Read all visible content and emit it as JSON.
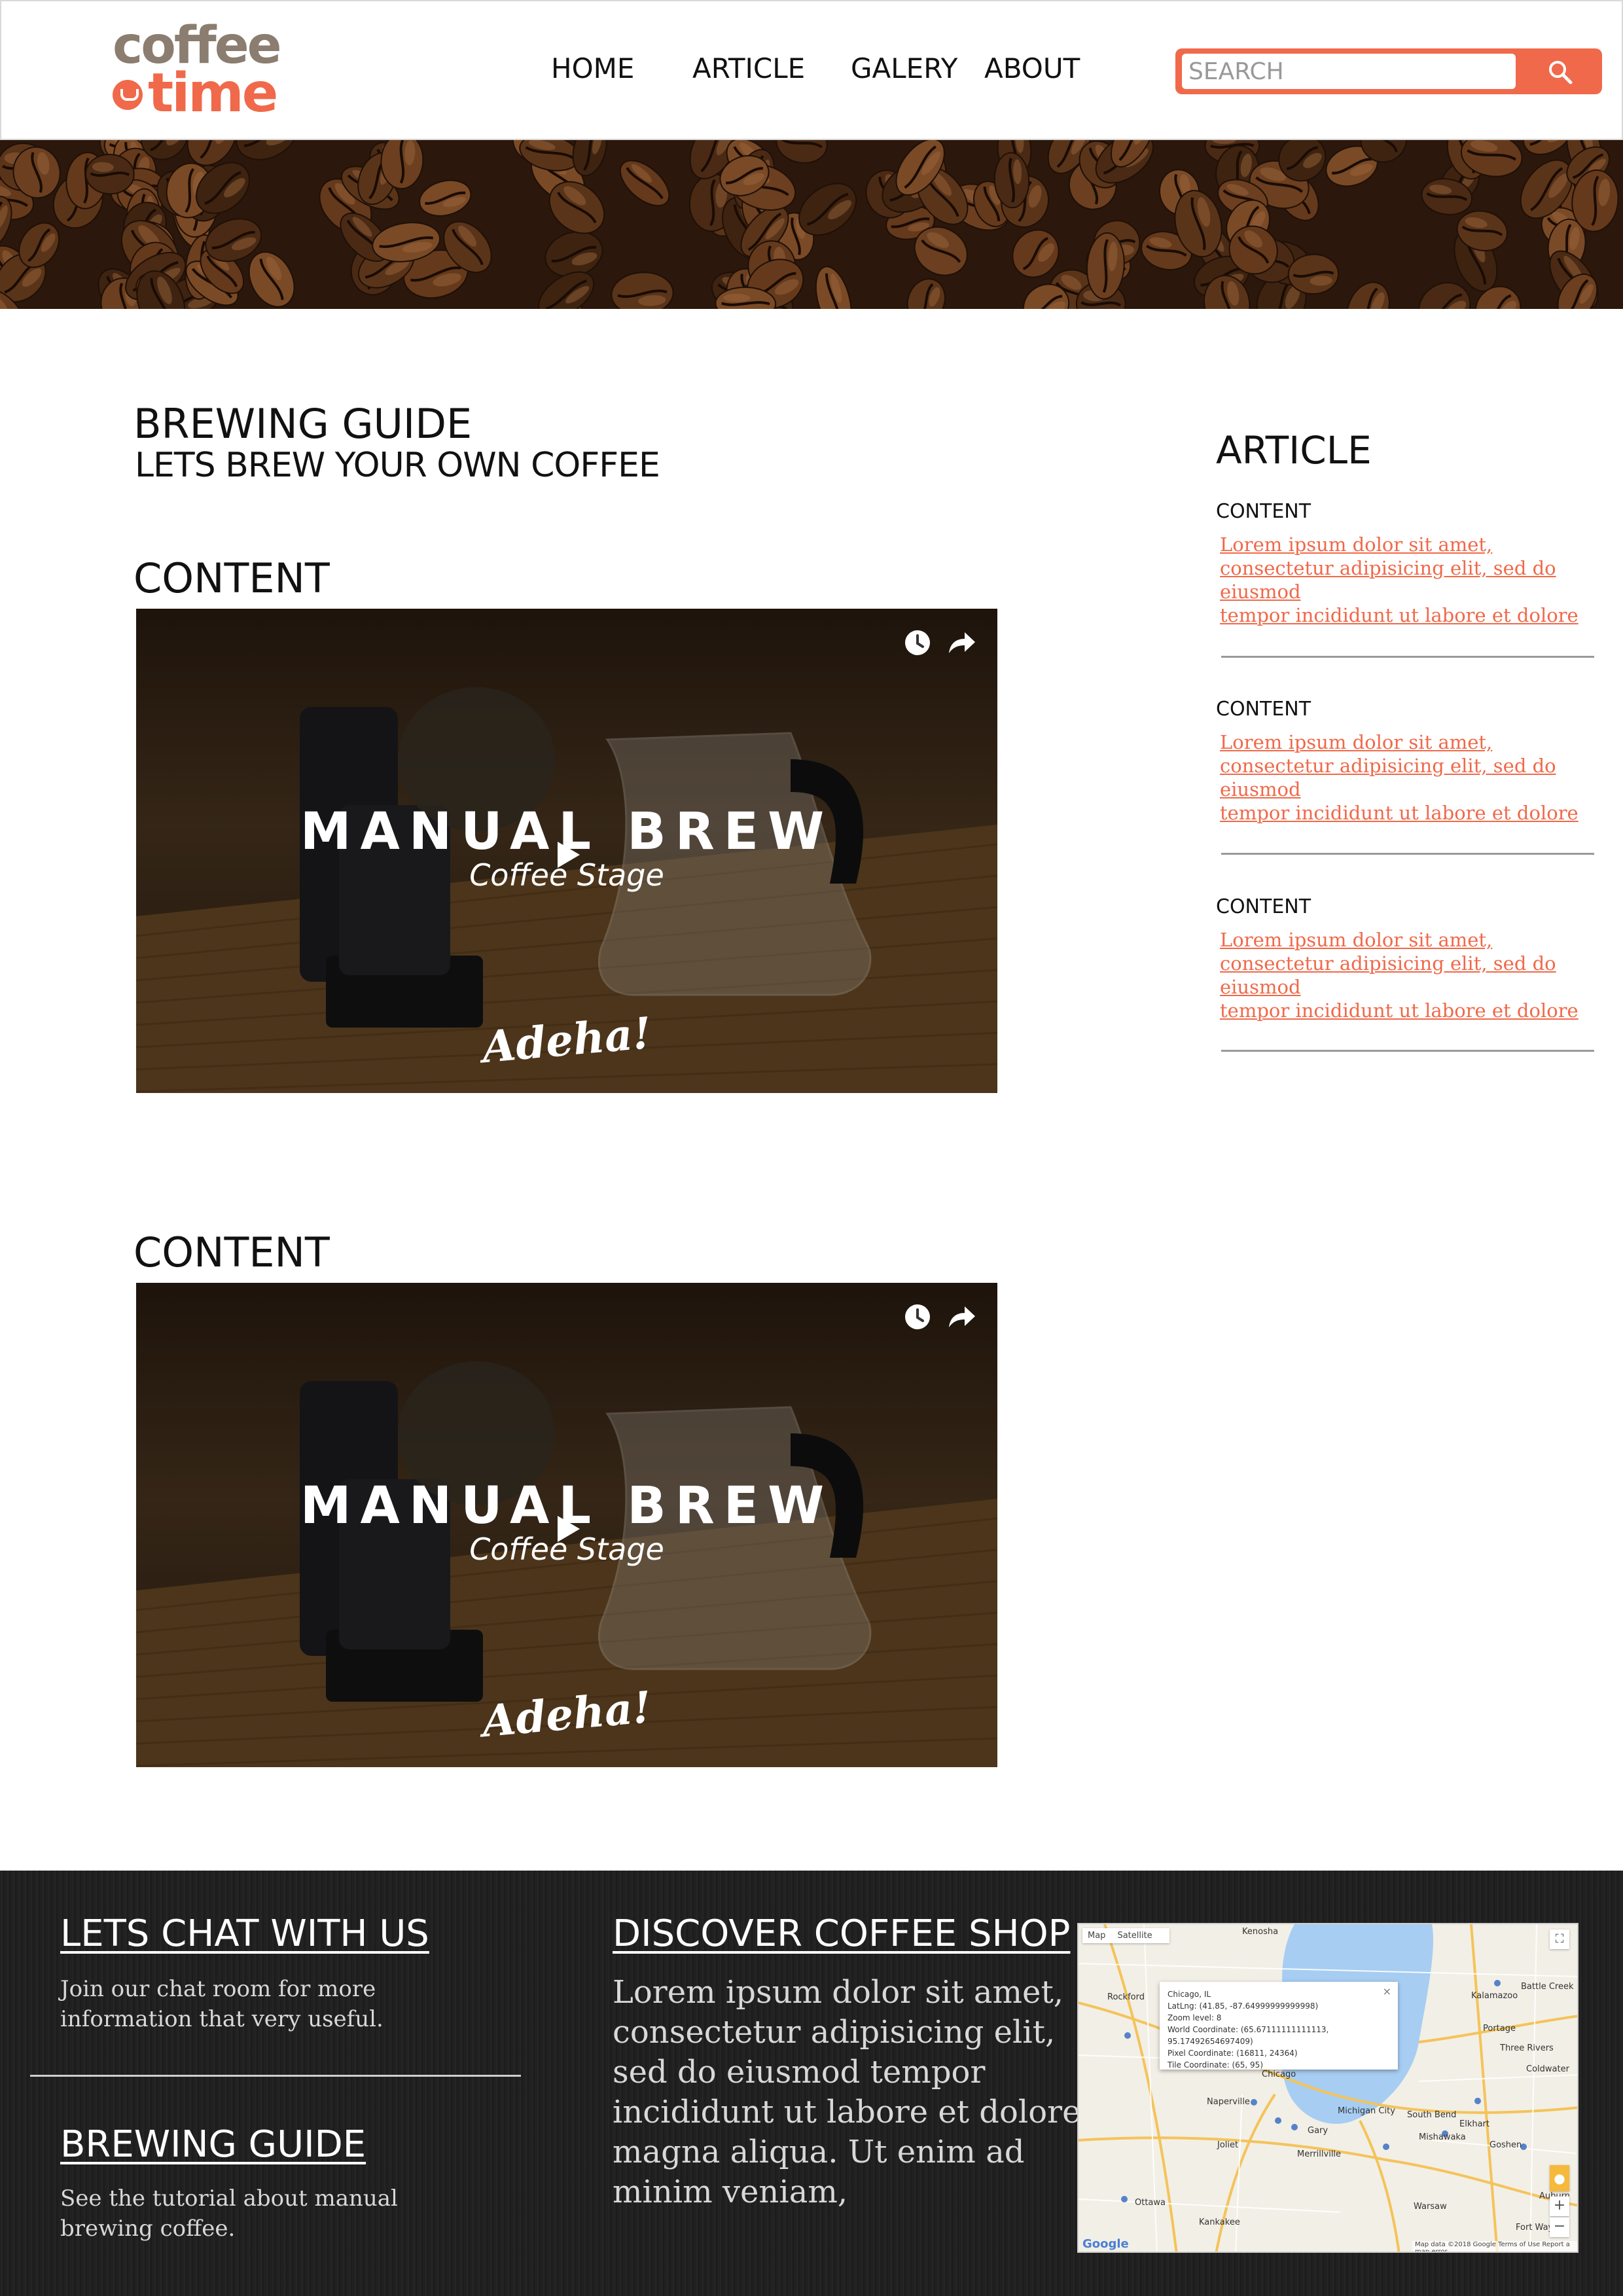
{
  "brand": {
    "logo_line1": "coffee",
    "logo_line2": "time",
    "colors": {
      "accent": "#f0694a",
      "logo_grey": "#8b7d6f",
      "footer_bg": "#1e1e1e",
      "link": "#f0694a"
    }
  },
  "nav": {
    "items": [
      {
        "label": "HOME"
      },
      {
        "label": "ARTICLE"
      },
      {
        "label": "GALERY"
      },
      {
        "label": "ABOUT"
      }
    ]
  },
  "search": {
    "placeholder": "SEARCH",
    "icon": "search-icon"
  },
  "banner": {
    "image": "coffee-beans"
  },
  "main": {
    "title": "BREWING GUIDE",
    "subtitle": "LETS BREW YOUR OWN COFFEE",
    "sections": [
      {
        "heading": "CONTENT",
        "video": {
          "title": "MANUAL BREW",
          "subtitle": "Coffee Stage",
          "brand": "Adeha!",
          "icons": [
            "clock-icon",
            "share-icon",
            "play-icon"
          ]
        }
      },
      {
        "heading": "CONTENT",
        "video": {
          "title": "MANUAL BREW",
          "subtitle": "Coffee Stage",
          "brand": "Adeha!",
          "icons": [
            "clock-icon",
            "share-icon",
            "play-icon"
          ]
        }
      }
    ]
  },
  "sidebar": {
    "title": "ARTICLE",
    "items": [
      {
        "label": "CONTENT",
        "lines": [
          "Lorem ipsum dolor sit amet,",
          "consectetur adipisicing  elit, sed do",
          "eiusmod",
          "tempor incididunt ut labore et dolore"
        ]
      },
      {
        "label": "CONTENT",
        "lines": [
          "Lorem ipsum dolor sit amet,",
          "consectetur adipisicing  elit, sed do",
          "eiusmod",
          "tempor incididunt ut labore et dolore"
        ]
      },
      {
        "label": "CONTENT",
        "lines": [
          "Lorem ipsum dolor sit amet,",
          "consectetur adipisicing  elit, sed do",
          "eiusmod",
          "tempor incididunt ut labore et dolore"
        ]
      }
    ]
  },
  "footer": {
    "chat": {
      "heading": "LETS CHAT WITH US",
      "lines": [
        "Join our chat room for more",
        "information that very useful."
      ]
    },
    "guide": {
      "heading": "BREWING GUIDE",
      "lines": [
        "See the tutorial about manual",
        "brewing coffee."
      ]
    },
    "discover": {
      "heading": "DISCOVER COFFEE SHOP",
      "lines": [
        "Lorem ipsum dolor sit amet,",
        "consectetur adipisicing elit,",
        "sed do eiusmod tempor",
        "incididunt ut labore et dolore",
        "magna aliqua. Ut enim ad",
        "minim veniam,"
      ]
    },
    "map": {
      "tabs": [
        "Map",
        "Satellite"
      ],
      "info": [
        "Chicago, IL",
        "LatLng: (41.85, -87.64999999999998)",
        "Zoom level: 8",
        "World Coordinate: (65.67111111111113, 95.17492654697409)",
        "Pixel Coordinate: (16811, 24364)",
        "Tile Coordinate: (65, 95)"
      ],
      "cities": [
        "Kenosha",
        "Rockford",
        "Kalamazoo",
        "Battle Creek",
        "Naperville",
        "Chicago",
        "Portage",
        "Joliet",
        "Gary",
        "Michigan City",
        "South Bend",
        "Elkhart",
        "Merrillville",
        "Mishawaka",
        "Ottawa",
        "Goshen",
        "Kankakee",
        "Warsaw",
        "Fort Wayne",
        "Auburn",
        "Coldwater",
        "Three Rivers"
      ],
      "google": "Google",
      "attribution": "Map data ©2018 Google   Terms of Use   Report a map error",
      "controls": {
        "fullscreen": "⛶",
        "zoom_in": "+",
        "zoom_out": "−"
      }
    }
  }
}
